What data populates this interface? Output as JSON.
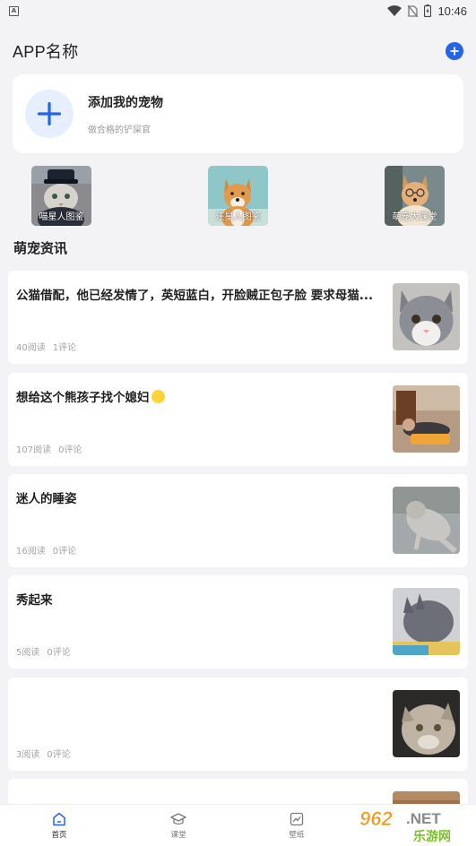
{
  "status_bar": {
    "app_badge": "A",
    "time": "10:46"
  },
  "header": {
    "title": "APP名称",
    "add_icon": "plus-circle-icon"
  },
  "add_pet": {
    "title": "添加我的宠物",
    "subtitle": "做合格的铲屎官"
  },
  "categories": [
    {
      "label": "喵星人图鉴"
    },
    {
      "label": "汪星人图鉴"
    },
    {
      "label": "萌宠大课堂"
    }
  ],
  "section_title": "萌宠资讯",
  "news": [
    {
      "title": "公猫借配，他已经发情了，英短蓝白，开脸贼正包子脸 要求母猫...",
      "reads": "40阅读",
      "comments": "1评论"
    },
    {
      "title": "想给这个熊孩子找个媳妇",
      "reads": "107阅读",
      "comments": "0评论"
    },
    {
      "title": "迷人的睡姿",
      "reads": "16阅读",
      "comments": "0评论"
    },
    {
      "title": "秀起来",
      "reads": "5阅读",
      "comments": "0评论"
    },
    {
      "title": "",
      "reads": "3阅读",
      "comments": "0评论"
    }
  ],
  "bottom_nav": [
    {
      "label": "首页",
      "icon": "home-icon"
    },
    {
      "label": "课堂",
      "icon": "graduation-cap-icon"
    },
    {
      "label": "壁纸",
      "icon": "picture-icon"
    }
  ],
  "watermark": {
    "brand": "962",
    "suffix": ".NET",
    "sub": "乐游网"
  },
  "colors": {
    "accent": "#2563e8",
    "background": "#f3f3f5"
  }
}
